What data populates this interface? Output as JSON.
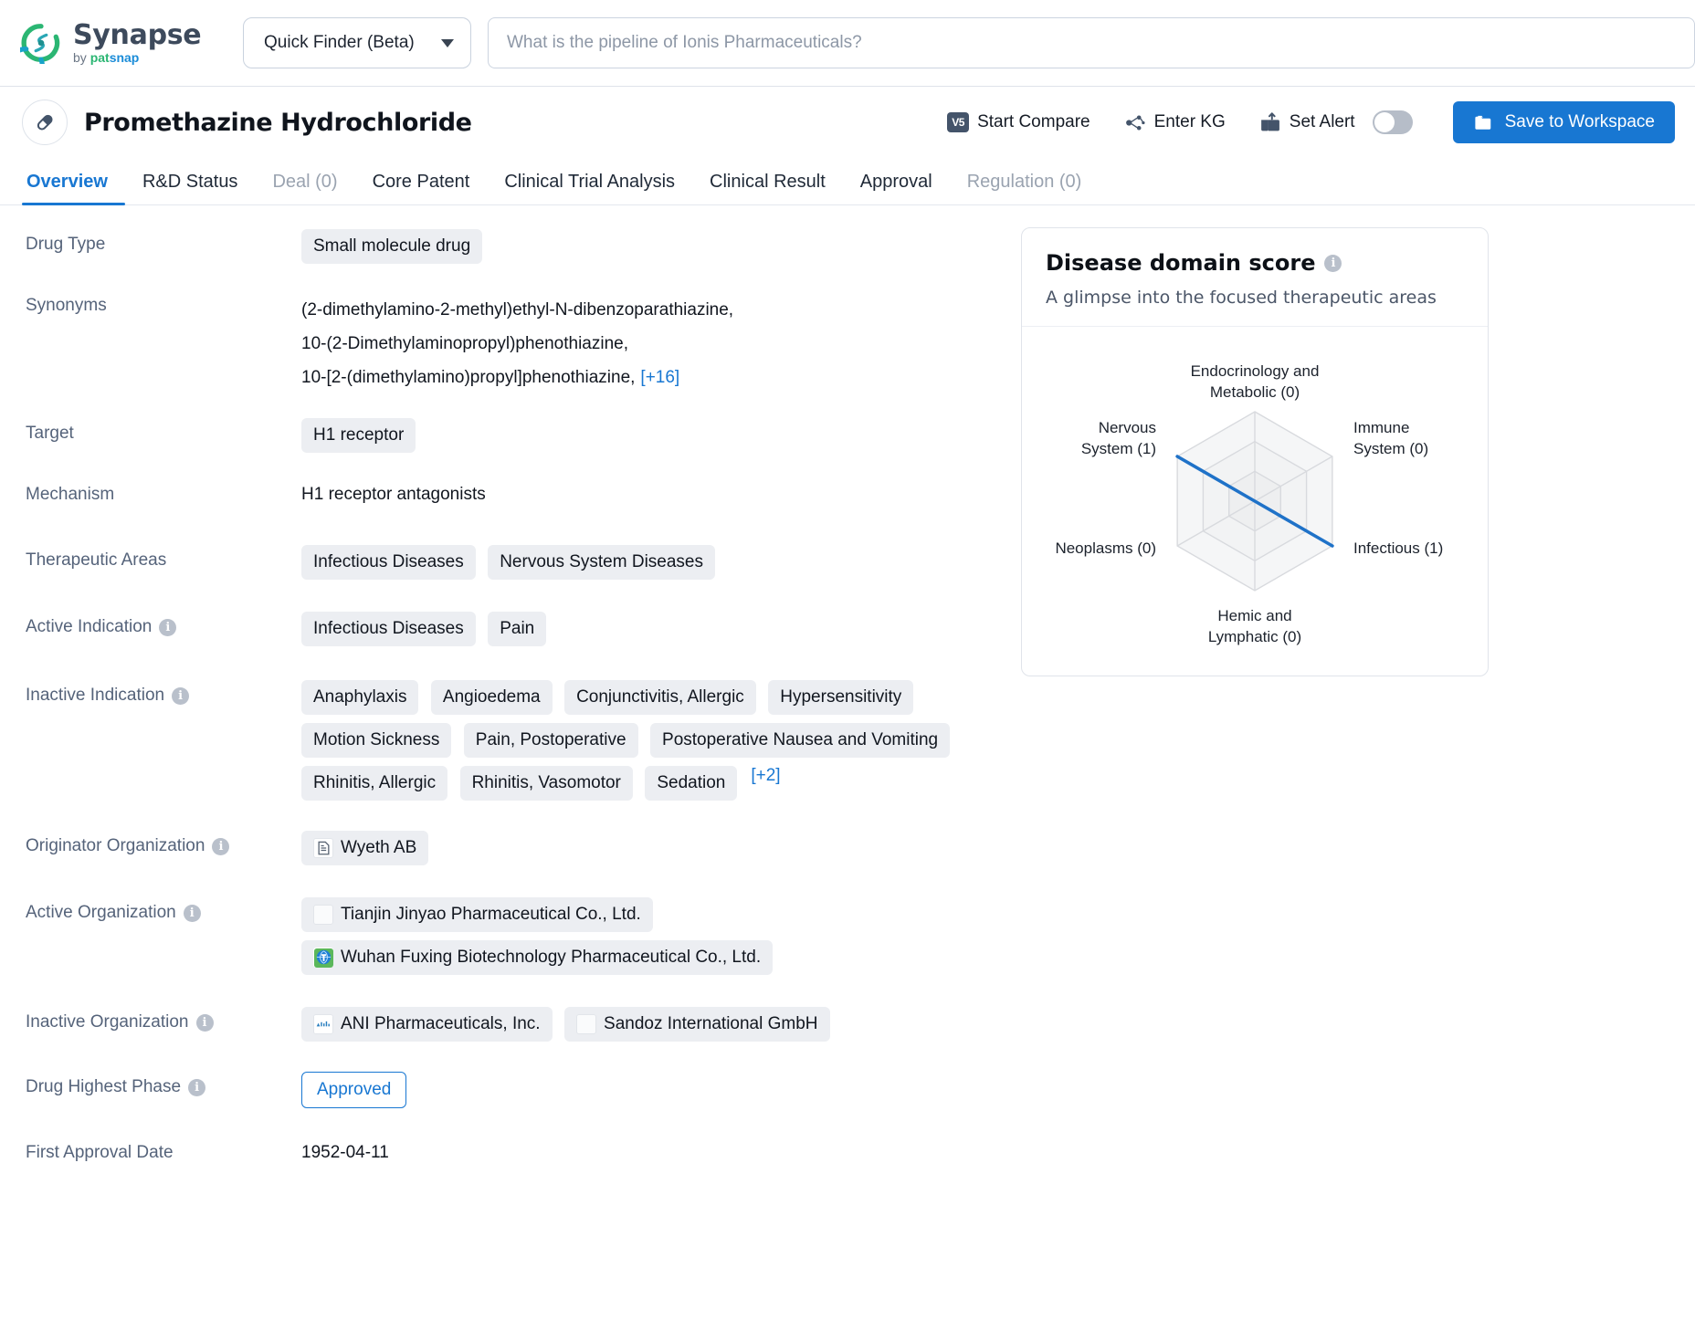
{
  "brand": {
    "name": "Synapse",
    "by": "by ",
    "pat": "pat",
    "snap": "snap",
    "accent": "#1877d2",
    "logo_green": "#2bb673",
    "logo_blue": "#1a8cd8"
  },
  "topbar": {
    "finder_label": "Quick Finder (Beta)",
    "search_placeholder": "What is the pipeline of Ionis Pharmaceuticals?",
    "search_value": ""
  },
  "drug_header": {
    "title": "Promethazine Hydrochloride",
    "start_compare": "Start Compare",
    "start_compare_badge": "V5",
    "enter_kg": "Enter KG",
    "set_alert": "Set Alert",
    "alert_enabled": false,
    "save_to_workspace": "Save to Workspace"
  },
  "tabs": [
    {
      "label": "Overview",
      "state": "active"
    },
    {
      "label": "R&D Status",
      "state": "normal"
    },
    {
      "label": "Deal (0)",
      "state": "muted"
    },
    {
      "label": "Core Patent",
      "state": "normal"
    },
    {
      "label": "Clinical Trial Analysis",
      "state": "normal"
    },
    {
      "label": "Clinical Result",
      "state": "normal"
    },
    {
      "label": "Approval",
      "state": "normal"
    },
    {
      "label": "Regulation (0)",
      "state": "muted"
    }
  ],
  "fields": {
    "drug_type": {
      "label": "Drug Type",
      "values": [
        "Small molecule drug"
      ]
    },
    "synonyms": {
      "label": "Synonyms",
      "lines": [
        "(2-dimethylamino-2-methyl)ethyl-N-dibenzoparathiazine,",
        "10-(2-Dimethylaminopropyl)phenothiazine,",
        "10-[2-(dimethylamino)propyl]phenothiazine,"
      ],
      "more": "[+16]"
    },
    "target": {
      "label": "Target",
      "values": [
        "H1 receptor"
      ]
    },
    "mechanism": {
      "label": "Mechanism",
      "value": "H1 receptor antagonists"
    },
    "therapeutic_areas": {
      "label": "Therapeutic Areas",
      "values": [
        "Infectious Diseases",
        "Nervous System Diseases"
      ]
    },
    "active_indication": {
      "label": "Active Indication",
      "values": [
        "Infectious Diseases",
        "Pain"
      ]
    },
    "inactive_indication": {
      "label": "Inactive Indication",
      "values": [
        "Anaphylaxis",
        "Angioedema",
        "Conjunctivitis, Allergic",
        "Hypersensitivity",
        "Motion Sickness",
        "Pain, Postoperative",
        "Postoperative Nausea and Vomiting",
        "Rhinitis, Allergic",
        "Rhinitis, Vasomotor",
        "Sedation"
      ],
      "more": "[+2]"
    },
    "originator_organization": {
      "label": "Originator Organization",
      "values": [
        {
          "name": "Wyeth AB",
          "logo": "document-logo"
        }
      ]
    },
    "active_organization": {
      "label": "Active Organization",
      "values": [
        {
          "name": "Tianjin Jinyao Pharmaceutical Co., Ltd.",
          "logo": "blank-logo"
        },
        {
          "name": "Wuhan Fuxing Biotechnology Pharmaceutical Co., Ltd.",
          "logo": "globe-logo"
        }
      ]
    },
    "inactive_organization": {
      "label": "Inactive Organization",
      "values": [
        {
          "name": "ANI Pharmaceuticals, Inc.",
          "logo": "ani-logo"
        },
        {
          "name": "Sandoz International GmbH",
          "logo": "blank-logo"
        }
      ]
    },
    "drug_highest_phase": {
      "label": "Drug Highest Phase",
      "value": "Approved"
    },
    "first_approval_date": {
      "label": "First Approval Date",
      "value": "1952-04-11"
    }
  },
  "radar_panel": {
    "title": "Disease domain score",
    "subtitle": "A glimpse into the focused therapeutic areas"
  },
  "chart_data": {
    "type": "radar",
    "title": "Disease domain score",
    "subtitle": "A glimpse into the focused therapeutic areas",
    "categories": [
      "Endocrinology and Metabolic",
      "Immune System",
      "Infectious",
      "Hemic and Lymphatic",
      "Neoplasms",
      "Nervous System"
    ],
    "tick_labels": [
      "Endocrinology and\nMetabolic (0)",
      "Immune\nSystem (0)",
      "Infectious (1)",
      "Hemic and\nLymphatic (0)",
      "Neoplasms (0)",
      "Nervous\nSystem (1)"
    ],
    "values": [
      0,
      0,
      1,
      0,
      0,
      1
    ],
    "rmax": 1,
    "rings": 3,
    "grid": true,
    "series_color": "#1f72c8",
    "grid_color": "#d8dade",
    "fill_color": "#f4f5f6",
    "legend": "none"
  }
}
